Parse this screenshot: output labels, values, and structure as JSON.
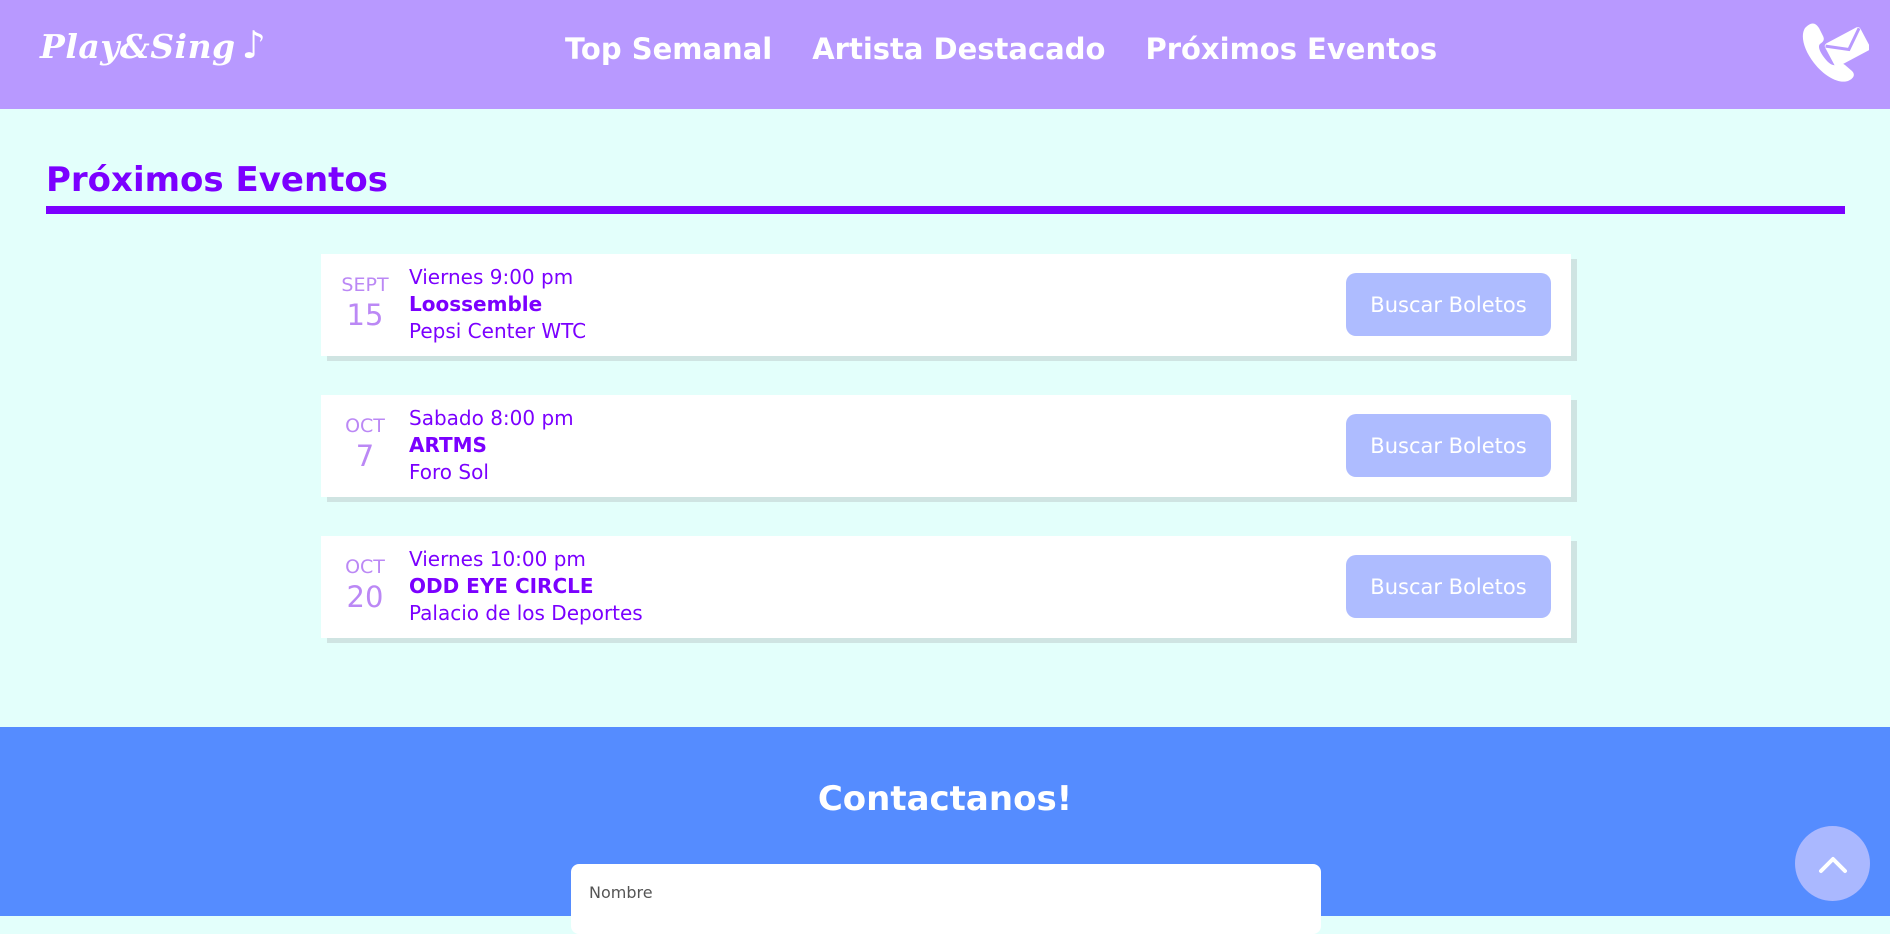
{
  "header": {
    "logo": "Play&Sing",
    "logo_note": "♪",
    "nav": [
      "Top Semanal",
      "Artista Destacado",
      "Próximos Eventos"
    ],
    "contact_icon": "phone-mail-icon"
  },
  "events_section": {
    "title": "Próximos Eventos",
    "events": [
      {
        "month": "SEPT",
        "day": "15",
        "time": "Viernes 9:00 pm",
        "artist": "Loossemble",
        "venue": "Pepsi Center WTC",
        "button": "Buscar Boletos"
      },
      {
        "month": "OCT",
        "day": "7",
        "time": "Sabado 8:00 pm",
        "artist": "ARTMS",
        "venue": "Foro Sol",
        "button": "Buscar Boletos"
      },
      {
        "month": "OCT",
        "day": "20",
        "time": "Viernes 10:00 pm",
        "artist": "ODD EYE CIRCLE",
        "venue": "Palacio de los Deportes",
        "button": "Buscar Boletos"
      }
    ]
  },
  "contact": {
    "title": "Contactanos!",
    "name_placeholder": "Nombre"
  },
  "scroll_top_icon": "chevron-up-icon",
  "colors": {
    "header_bg": "#b899ff",
    "page_bg": "#e3fffb",
    "accent": "#7b00ff",
    "button_bg": "#aebcff",
    "contact_bg": "#558cff"
  }
}
